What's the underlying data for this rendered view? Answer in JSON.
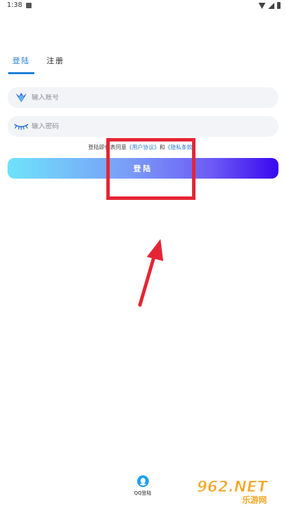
{
  "status_bar": {
    "time": "1:38"
  },
  "tabs": [
    {
      "label": "登陆",
      "active": true
    },
    {
      "label": "注册",
      "active": false
    }
  ],
  "form": {
    "account_placeholder": "输入账号",
    "password_placeholder": "输入密码"
  },
  "agreement": {
    "prefix": "登陆即代表同意",
    "user_agreement": "《用户协议》",
    "and": "和",
    "privacy": "《隐私条款》"
  },
  "login_button": {
    "label": "登陆"
  },
  "qq_login": {
    "label": "QQ登陆"
  },
  "watermark": {
    "text": "962.NET",
    "sub": "乐游网"
  },
  "colors": {
    "accent": "#1e7fd8",
    "gradient_start": "#6ee3fb",
    "gradient_end": "#3b07f0",
    "annotation": "#e42535"
  }
}
